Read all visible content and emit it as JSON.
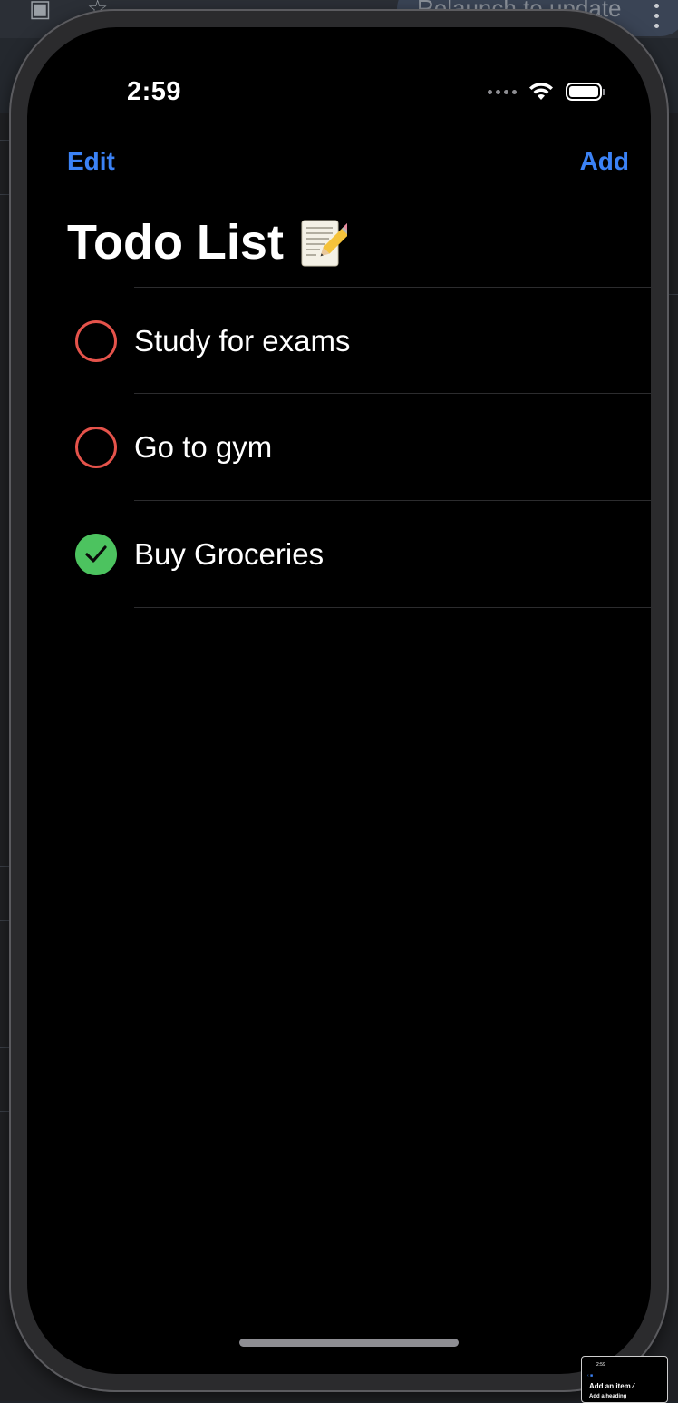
{
  "browser": {
    "update_button": "Relaunch to update"
  },
  "status_bar": {
    "time": "2:59"
  },
  "nav": {
    "edit_label": "Edit",
    "add_label": "Add"
  },
  "page": {
    "title": "Todo List",
    "title_icon": "memo-icon"
  },
  "todos": [
    {
      "label": "Study for exams",
      "completed": false
    },
    {
      "label": "Go to gym",
      "completed": false
    },
    {
      "label": "Buy Groceries",
      "completed": true
    }
  ],
  "colors": {
    "accent": "#3b82f6",
    "incomplete": "#e5534b",
    "complete": "#4cc35f",
    "background": "#000000"
  },
  "thumbnail": {
    "time": "2:59",
    "heading": "Add an item",
    "subheading": "Add a heading"
  }
}
